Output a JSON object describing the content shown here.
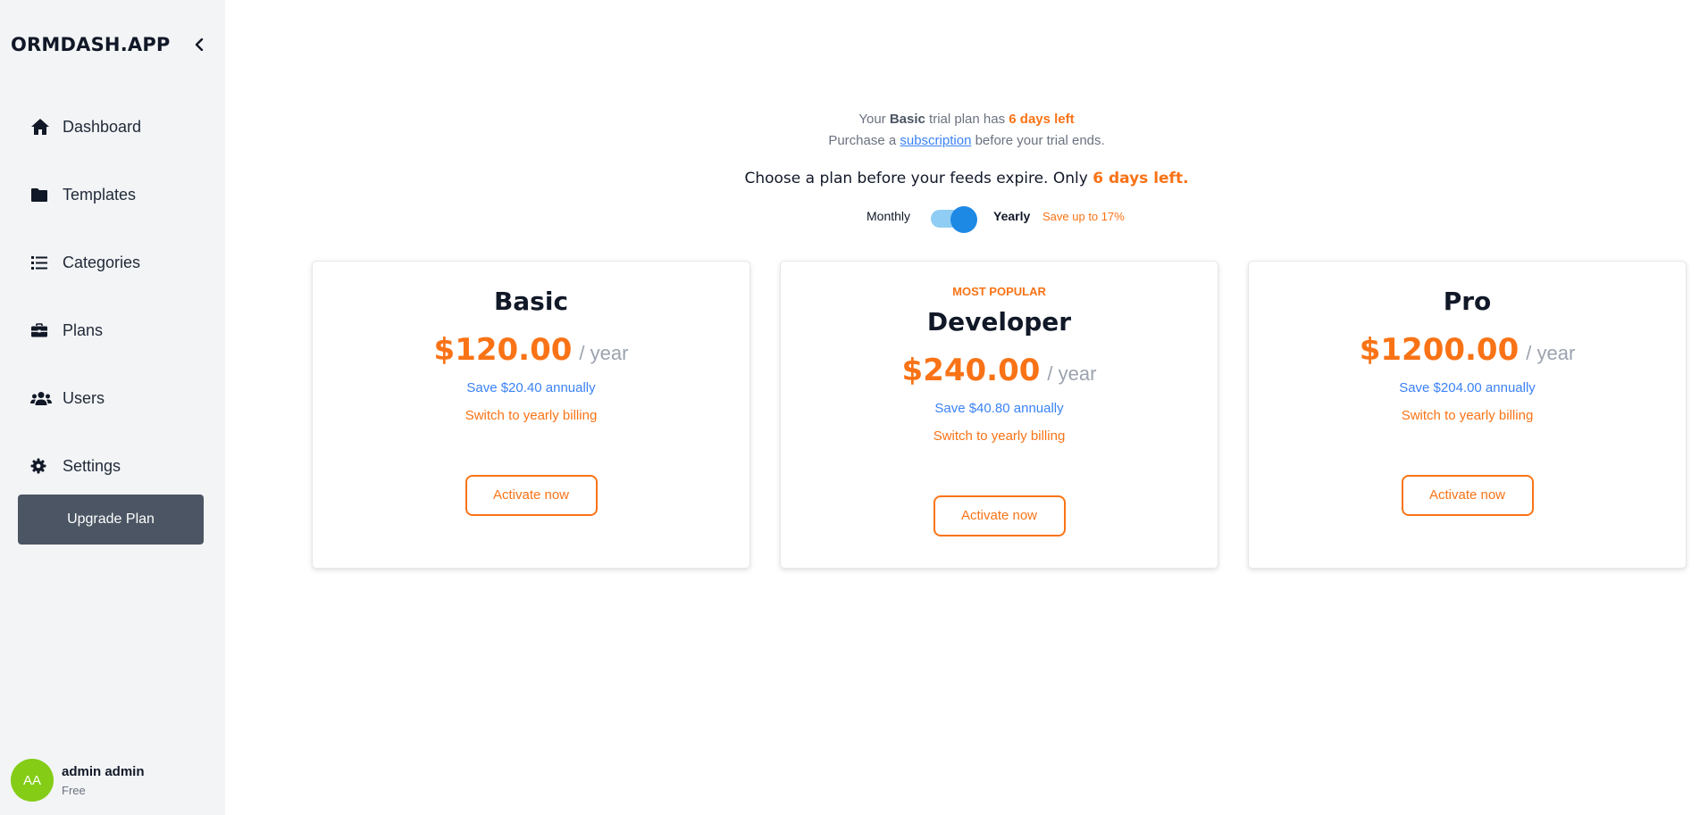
{
  "sidebar": {
    "brand": "ORMDASH.APP",
    "collapse_icon": "chevron-left-icon",
    "items": [
      {
        "label": "Dashboard",
        "icon": "home-icon"
      },
      {
        "label": "Templates",
        "icon": "folder-icon"
      },
      {
        "label": "Categories",
        "icon": "list-icon"
      },
      {
        "label": "Plans",
        "icon": "briefcase-icon"
      },
      {
        "label": "Users",
        "icon": "users-icon"
      },
      {
        "label": "Settings",
        "icon": "gear-icon"
      }
    ],
    "upgrade_label": "Upgrade Plan",
    "user": {
      "initials": "AA",
      "name": "admin admin",
      "plan": "Free"
    }
  },
  "trial": {
    "l1_a": "Your ",
    "l1_plan": "Basic",
    "l1_b": " trial plan has ",
    "l1_days": "6 days left",
    "l2_a": "Purchase a ",
    "l2_link": "subscription",
    "l2_b": " before your trial ends."
  },
  "choose": {
    "text": "Choose a plan before your feeds expire. Only ",
    "days": "6 days left."
  },
  "billing_toggle": {
    "monthly": "Monthly",
    "yearly": "Yearly",
    "save": "Save up to 17%",
    "selected": "Yearly"
  },
  "plans": [
    {
      "name": "Basic",
      "badge": "",
      "price": "$120.00",
      "period": "/ year",
      "save": "Save $20.40 annually",
      "switch": "Switch to yearly billing",
      "cta": "Activate now"
    },
    {
      "name": "Developer",
      "badge": "MOST POPULAR",
      "price": "$240.00",
      "period": "/ year",
      "save": "Save $40.80 annually",
      "switch": "Switch to yearly billing",
      "cta": "Activate now"
    },
    {
      "name": "Pro",
      "badge": "",
      "price": "$1200.00",
      "period": "/ year",
      "save": "Save $204.00 annually",
      "switch": "Switch to yearly billing",
      "cta": "Activate now"
    }
  ],
  "colors": {
    "accent": "#f97316",
    "link": "#3b82f6",
    "sidebar_bg": "#f3f4f6",
    "upgrade_bg": "#4b5563",
    "avatar": "#84cc16",
    "toggle": "#1e88e5"
  }
}
